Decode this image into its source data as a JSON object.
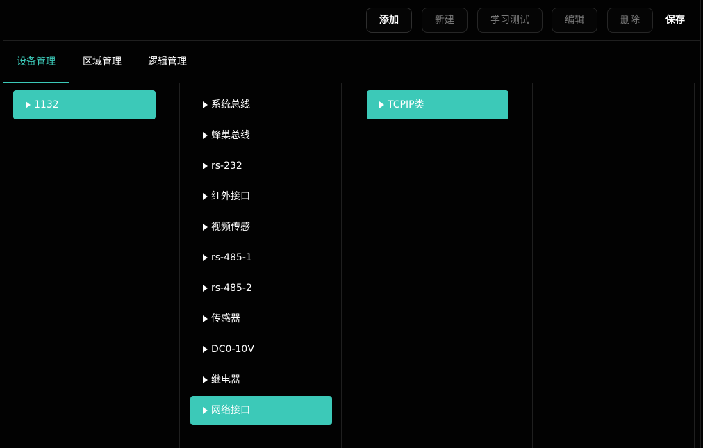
{
  "toolbar": {
    "add_label": "添加",
    "new_label": "新建",
    "learn_test_label": "学习测试",
    "edit_label": "编辑",
    "delete_label": "删除",
    "save_label": "保存"
  },
  "tabs": [
    {
      "label": "设备管理",
      "active": true
    },
    {
      "label": "区域管理",
      "active": false
    },
    {
      "label": "逻辑管理",
      "active": false
    }
  ],
  "columns": {
    "devices": [
      {
        "label": "1132",
        "selected": true,
        "icon": "caret-right-icon"
      }
    ],
    "interfaces": [
      {
        "label": "系统总线",
        "selected": false
      },
      {
        "label": "蜂巢总线",
        "selected": false
      },
      {
        "label": "rs-232",
        "selected": false
      },
      {
        "label": "红外接口",
        "selected": false
      },
      {
        "label": "视频传感",
        "selected": false
      },
      {
        "label": "rs-485-1",
        "selected": false
      },
      {
        "label": "rs-485-2",
        "selected": false
      },
      {
        "label": "传感器",
        "selected": false
      },
      {
        "label": "DC0-10V",
        "selected": false
      },
      {
        "label": "继电器",
        "selected": false
      },
      {
        "label": "网络接口",
        "selected": true
      }
    ],
    "types": [
      {
        "label": "TCPIP类",
        "selected": true
      }
    ]
  },
  "colors": {
    "accent": "#3cc9b8",
    "background": "#020202",
    "text": "#ffffff",
    "disabled_text": "#7a7a7a",
    "border": "#262626"
  }
}
